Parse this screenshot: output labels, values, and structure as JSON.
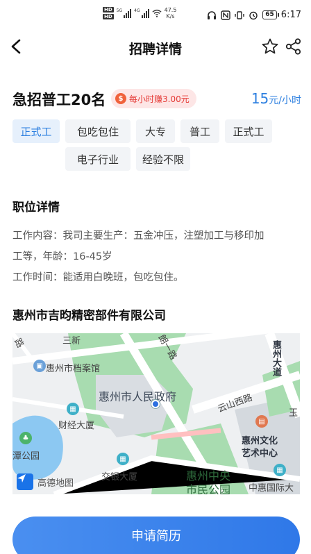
{
  "status_bar": {
    "hd1": "HD",
    "hd2": "HD",
    "sig1": "5G",
    "sig2": "4G",
    "speed_value": "47.5",
    "speed_unit": "K/s",
    "battery": "65",
    "time": "6:17"
  },
  "nav": {
    "title": "招聘详情"
  },
  "job": {
    "title": "急招普工20名",
    "hourly_badge": "每小时赚3.00元",
    "salary_num": "15",
    "salary_unit": "元/小时"
  },
  "tags": [
    "正式工",
    "包吃包住",
    "大专",
    "普工",
    "正式工",
    "电子行业",
    "经验不限"
  ],
  "details": {
    "title": "职位详情",
    "line1": "工作内容：我司主要生产：五金冲压，注塑加工与移印加",
    "line2": "工等，年龄：16-45岁",
    "line3": "工作时间：能适用白晚班，包吃包住。"
  },
  "company": {
    "name": "惠州市吉昀精密部件有限公司"
  },
  "map": {
    "labels": {
      "archive": "惠州市档案馆",
      "gov": "惠州市人民政府",
      "finance": "财经大厦",
      "park": "潭公园",
      "jiaoyin": "交银大厦",
      "yunshan": "云山西路",
      "culture1": "惠州文化",
      "culture2": "艺术中心",
      "central1": "惠州中央",
      "central2": "市民公园",
      "zhonghui": "中惠国际大",
      "dadao": "惠州大道",
      "yu": "玉",
      "sanxin": "三新",
      "yilu": "朗一路"
    },
    "logo": "高德地图",
    "colors": {
      "water": "#8cc8f2",
      "green": "#a8dcb0",
      "road": "#ffffff"
    }
  },
  "apply_button": "申请简历",
  "colors": {
    "accent": "#2c7fe0",
    "badge_bg": "#fde6e6",
    "badge_text": "#e53935"
  }
}
